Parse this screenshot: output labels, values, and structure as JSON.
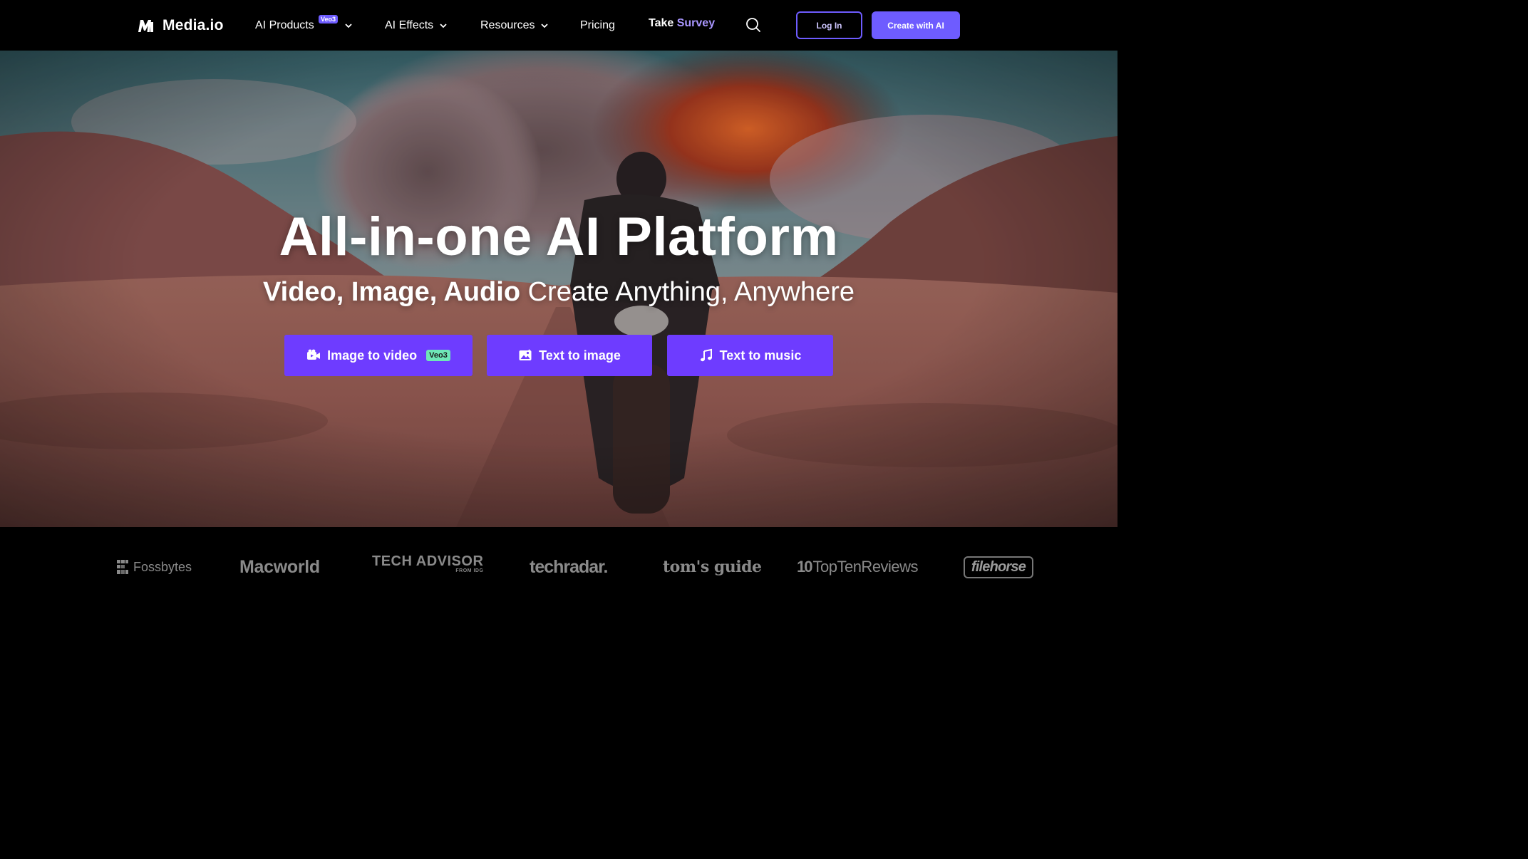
{
  "brand": {
    "name": "Media.io"
  },
  "nav": {
    "items": [
      {
        "label": "AI Products",
        "badge": "Veo3",
        "has_dropdown": true
      },
      {
        "label": "AI Effects",
        "has_dropdown": true
      },
      {
        "label": "Resources",
        "has_dropdown": true
      },
      {
        "label": "Pricing",
        "has_dropdown": false
      }
    ],
    "survey": {
      "prefix": "Take",
      "highlight": "Survey"
    },
    "search_icon": "search-icon",
    "login_label": "Log In",
    "create_label": "Create with AI"
  },
  "hero": {
    "title": "All-in-one AI Platform",
    "subtitle_strong": "Video, Image, Audio",
    "subtitle_rest": "Create Anything, Anywhere",
    "ctas": [
      {
        "label": "Image to video",
        "badge": "Veo3",
        "icon": "video-camera-icon"
      },
      {
        "label": "Text to image",
        "icon": "image-icon"
      },
      {
        "label": "Text to music",
        "icon": "music-note-icon"
      }
    ]
  },
  "press": {
    "logos": [
      "Fossbytes",
      "Macworld",
      "TECH ADVISOR",
      "FROM IDG",
      "techradar.",
      "tom's guide",
      "TopTenReviews",
      "filehorse"
    ]
  },
  "colors": {
    "accent": "#6e5cff",
    "cta": "#6e3cff",
    "badge_green": "#6ee7b7",
    "survey_highlight": "#a996ff"
  }
}
